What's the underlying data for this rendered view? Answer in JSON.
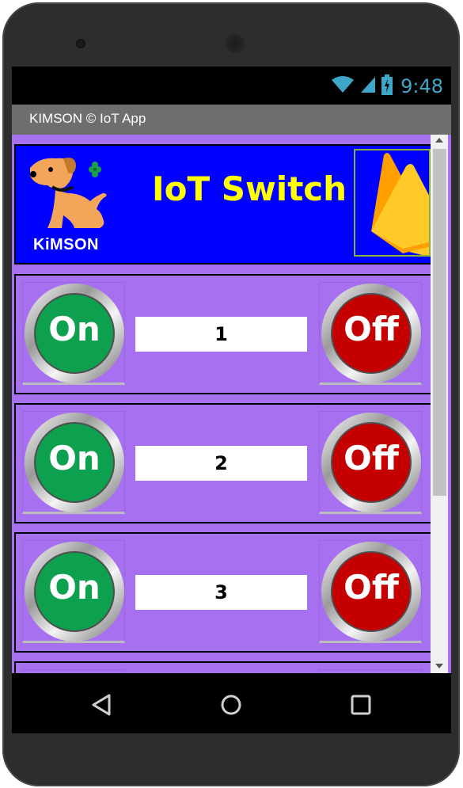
{
  "status_bar": {
    "time": "9:48",
    "icons": [
      "wifi-icon",
      "signal-icon",
      "battery-icon"
    ]
  },
  "app_bar": {
    "title": "KIMSON © IoT App"
  },
  "header": {
    "logo_text": "KiMSON",
    "title": "IoT Switch",
    "firebase_icon": "firebase-icon"
  },
  "switches": [
    {
      "label": "1",
      "on_label": "On",
      "off_label": "Off"
    },
    {
      "label": "2",
      "on_label": "On",
      "off_label": "Off"
    },
    {
      "label": "3",
      "on_label": "On",
      "off_label": "Off"
    }
  ],
  "nav": {
    "icons": [
      "back-icon",
      "home-icon",
      "recents-icon"
    ]
  },
  "colors": {
    "on": "#0da04e",
    "off": "#c40000",
    "panel": "#a770f0",
    "header_bg": "#0000ff",
    "title": "#ffff00"
  }
}
